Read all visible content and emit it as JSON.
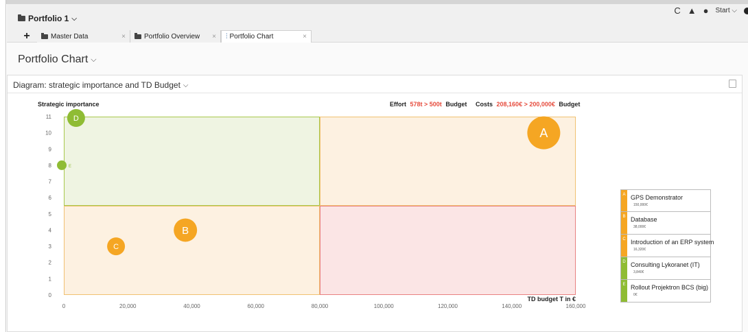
{
  "header": {
    "portfolio_title": "Portfolio 1",
    "tools": {
      "refresh": "C",
      "start_label": "Start"
    }
  },
  "tabs": [
    {
      "label": "Master Data"
    },
    {
      "label": "Portfolio Overview"
    },
    {
      "label": "Portfolio Chart",
      "active": true
    }
  ],
  "tab_close": "×",
  "page_title": "Portfolio Chart",
  "panel": {
    "title": "Diagram: strategic importance and TD Budget"
  },
  "info": {
    "effort_label": "Effort",
    "effort_value": "578t > 500t",
    "effort_suffix": "Budget",
    "costs_label": "Costs",
    "costs_value": "208,160€ > 200,000€",
    "costs_suffix": "Budget",
    "highlight_color": "#e64b3c"
  },
  "chart_data": {
    "type": "scatter",
    "ylabel": "Strategic importance",
    "xlabel": "TD budget T in €",
    "xlim": [
      0,
      160000
    ],
    "ylim": [
      0,
      11
    ],
    "x_ticks": [
      0,
      20000,
      40000,
      60000,
      80000,
      100000,
      120000,
      140000,
      160000
    ],
    "x_tick_labels": [
      "0",
      "20,000",
      "40,000",
      "60,000",
      "80,000",
      "100,000",
      "120,000",
      "140,000",
      "160,000"
    ],
    "y_ticks": [
      0,
      1,
      2,
      3,
      4,
      5,
      6,
      7,
      8,
      9,
      10,
      11
    ],
    "quadrants": [
      {
        "x": [
          0,
          80000
        ],
        "y": [
          5.5,
          11
        ],
        "fill": "#eff4e2",
        "stroke": "#a7c84b"
      },
      {
        "x": [
          80000,
          160000
        ],
        "y": [
          5.5,
          11
        ],
        "fill": "#fdf1e1",
        "stroke": "#f0c070"
      },
      {
        "x": [
          0,
          80000
        ],
        "y": [
          0,
          5.5
        ],
        "fill": "#fdf1e1",
        "stroke": "#f0c070"
      },
      {
        "x": [
          80000,
          160000
        ],
        "y": [
          0,
          5.5
        ],
        "fill": "#fbe5e5",
        "stroke": "#e88080"
      }
    ],
    "points": [
      {
        "label": "A",
        "x": 150000,
        "y": 10,
        "color": "#f5a623",
        "size": "large"
      },
      {
        "label": "B",
        "x": 38000,
        "y": 4,
        "color": "#f5a623",
        "size": "medium"
      },
      {
        "label": "C",
        "x": 16320,
        "y": 3,
        "color": "#f5a623",
        "size": "small"
      },
      {
        "label": "D",
        "x": 3840,
        "y": 11,
        "color": "#8fbc34",
        "size": "small"
      },
      {
        "label": "E",
        "x": 0,
        "y": 8,
        "color": "#8fbc34",
        "size": "dot",
        "outside_label": true
      }
    ],
    "grid": false
  },
  "legend": [
    {
      "letter": "A",
      "name": "GPS Demonstrator",
      "value": "150,000€",
      "color": "#f5a623"
    },
    {
      "letter": "B",
      "name": "Database",
      "value": "38,000€",
      "color": "#f5a623"
    },
    {
      "letter": "C",
      "name": "Introduction of an ERP system",
      "value": "16,320€",
      "color": "#f5a623"
    },
    {
      "letter": "D",
      "name": "Consulting Lykoranet (IT)",
      "value": "3,840€",
      "color": "#8fbc34"
    },
    {
      "letter": "E",
      "name": "Rollout Projektron BCS (big)",
      "value": "0€",
      "color": "#8fbc34"
    }
  ]
}
